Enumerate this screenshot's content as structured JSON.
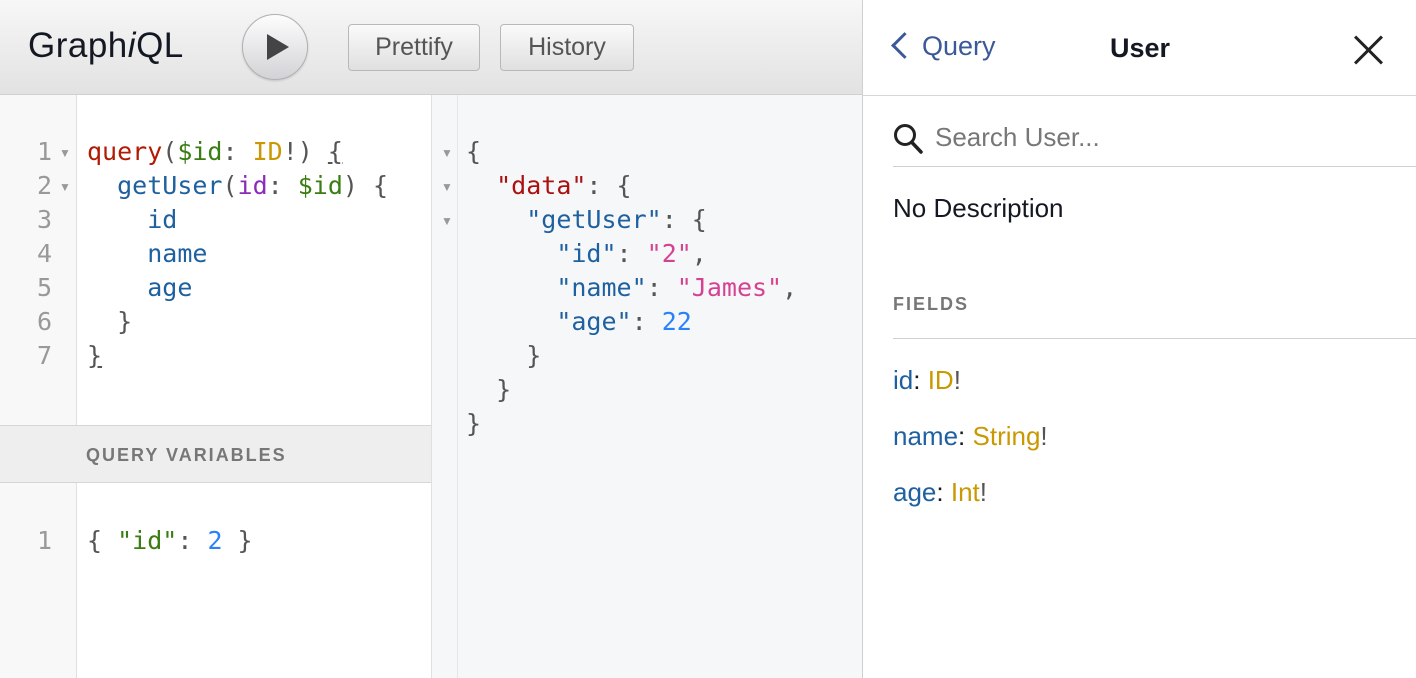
{
  "app": {
    "logo_prefix": "Graph",
    "logo_italic": "i",
    "logo_suffix": "QL"
  },
  "toolbar": {
    "prettify_label": "Prettify",
    "history_label": "History",
    "execute_icon": "play-icon"
  },
  "query_editor": {
    "line_numbers": [
      "1",
      "2",
      "3",
      "4",
      "5",
      "6",
      "7"
    ],
    "line1": {
      "kw": "query",
      "open": "(",
      "var": "$id",
      "colon": ": ",
      "type": "ID",
      "bang": "!",
      "close": ") ",
      "brace": "{"
    },
    "line2": {
      "field": "getUser",
      "open": "(",
      "arg": "id",
      "colon": ": ",
      "var": "$id",
      "close": ") ",
      "brace": "{"
    },
    "line3": {
      "field": "id"
    },
    "line4": {
      "field": "name"
    },
    "line5": {
      "field": "age"
    },
    "line6": {
      "brace": "}"
    },
    "line7": {
      "brace": "}"
    }
  },
  "variables": {
    "title": "QUERY VARIABLES",
    "line_number": "1",
    "open": "{ ",
    "key": "\"id\"",
    "colon": ": ",
    "value": "2",
    "close": " }"
  },
  "result": {
    "line1": "{",
    "line2": {
      "key": "\"data\"",
      "rest": ": {"
    },
    "line3": {
      "key": "\"getUser\"",
      "rest": ": {"
    },
    "line4": {
      "key": "\"id\"",
      "colon": ": ",
      "value": "\"2\"",
      "comma": ","
    },
    "line5": {
      "key": "\"name\"",
      "colon": ": ",
      "value": "\"James\"",
      "comma": ","
    },
    "line6": {
      "key": "\"age\"",
      "colon": ": ",
      "value": "22"
    },
    "line7": "}",
    "line8": "}",
    "line9": "}"
  },
  "doc_explorer": {
    "back_label": "Query",
    "title": "User",
    "search_placeholder": "Search User...",
    "description": "No Description",
    "fields_title": "FIELDS",
    "fields": [
      {
        "name": "id",
        "type": "ID",
        "bang": "!"
      },
      {
        "name": "name",
        "type": "String",
        "bang": "!"
      },
      {
        "name": "age",
        "type": "Int",
        "bang": "!"
      }
    ]
  }
}
